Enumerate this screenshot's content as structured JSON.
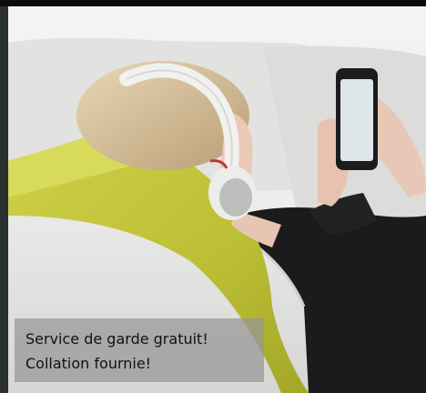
{
  "promo": {
    "line1": "Service de garde gratuit!",
    "line2": "Collation fournie!"
  },
  "colors": {
    "frame_dark": "#0b0b0b",
    "left_strip": "#2a3230",
    "pillow": "#c3c43a",
    "caption_overlay": "rgba(150,150,150,0.72)",
    "caption_text": "#111111"
  },
  "image": {
    "subject": "photo"
  }
}
